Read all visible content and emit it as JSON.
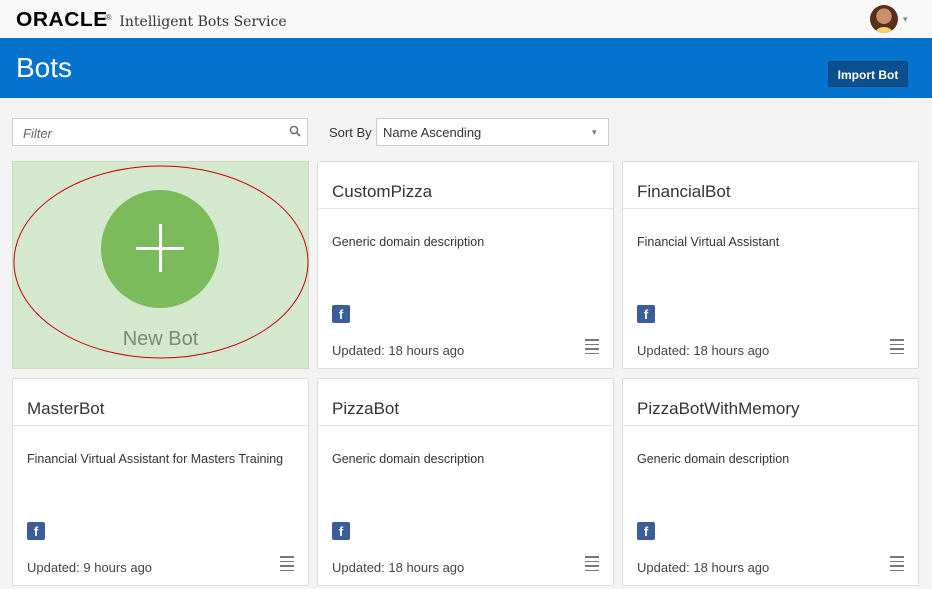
{
  "header": {
    "logo_word": "ORACLE",
    "logo_mark": "®",
    "service_name": "Intelligent Bots Service",
    "avatar": "user-avatar",
    "caret": "▾"
  },
  "titlebar": {
    "title": "Bots",
    "import_label": "Import Bot"
  },
  "toolbar": {
    "filter_placeholder": "Filter",
    "filter_value": "",
    "sort_label": "Sort By",
    "sort_value": "Name Ascending",
    "sort_caret": "▾"
  },
  "new_bot": {
    "label": "New Bot",
    "annotation_color": "#cc0000"
  },
  "colors": {
    "brand_blue": "#0572ce",
    "new_bot_bg": "#d3e8cc",
    "new_bot_circle": "#7cbb5b",
    "facebook_blue": "#3b5d99"
  },
  "bots": [
    {
      "name": "CustomPizza",
      "description": "Generic domain description",
      "channel_icon": "facebook-icon",
      "channel_glyph": "f",
      "updated": "Updated: 18 hours ago"
    },
    {
      "name": "FinancialBot",
      "description": "Financial Virtual Assistant",
      "channel_icon": "facebook-icon",
      "channel_glyph": "f",
      "updated": "Updated: 18 hours ago"
    },
    {
      "name": "MasterBot",
      "description": "Financial Virtual Assistant for Masters Training",
      "channel_icon": "facebook-icon",
      "channel_glyph": "f",
      "updated": "Updated: 9 hours ago"
    },
    {
      "name": "PizzaBot",
      "description": "Generic domain description",
      "channel_icon": "facebook-icon",
      "channel_glyph": "f",
      "updated": "Updated: 18 hours ago"
    },
    {
      "name": "PizzaBotWithMemory",
      "description": "Generic domain description",
      "channel_icon": "facebook-icon",
      "channel_glyph": "f",
      "updated": "Updated: 18 hours ago"
    }
  ]
}
